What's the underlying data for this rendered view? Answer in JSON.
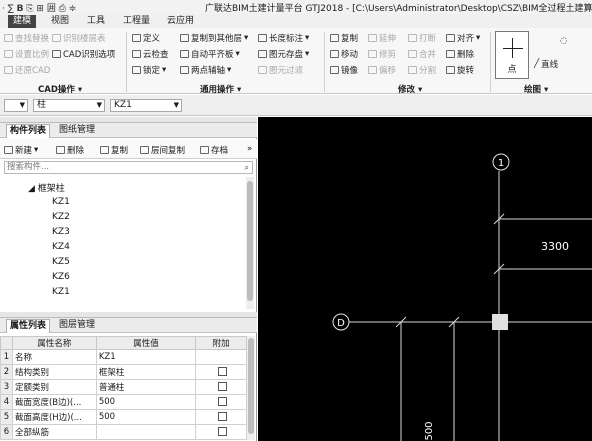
{
  "window": {
    "title": "广联达BIM土建计量平台 GTJ2018 - [C:\\Users\\Administrator\\Desktop\\CSZ\\BIM全过程土建算量实",
    "quick_access": "· ∑ 𝗕 ⎘ ⊞ 囲 ⎙ ≑"
  },
  "ribbon_tabs": [
    "建模",
    "视图",
    "工具",
    "工程量",
    "云应用"
  ],
  "ribbon": {
    "cad_group": {
      "label": "CAD操作",
      "commands": [
        "查找替换",
        "识别楼层表",
        "设置比例",
        "CAD识别选项",
        "还原CAD"
      ]
    },
    "general_group": {
      "label": "通用操作",
      "commands": [
        "定义",
        "复制到其他层",
        "长度标注",
        "云检查",
        "自动平齐板",
        "图元存盘",
        "锁定",
        "两点辅轴",
        "图元过滤"
      ]
    },
    "modify_group": {
      "label": "修改",
      "commands": [
        "复制",
        "延伸",
        "打断",
        "对齐",
        "移动",
        "修剪",
        "合并",
        "删除",
        "镜像",
        "偏移",
        "分割",
        "旋转"
      ]
    },
    "draw_group": {
      "label": "绘图",
      "point_label": "点",
      "line_label": "直线"
    }
  },
  "selectors": {
    "layer": "",
    "type": "柱",
    "component": "KZ1"
  },
  "component_panel": {
    "tabs": [
      "构件列表",
      "图纸管理"
    ],
    "toolbar": [
      "新建",
      "删除",
      "复制",
      "层间复制",
      "存档",
      "»"
    ],
    "search_placeholder": "搜索构件...",
    "tree_root": "框架柱",
    "items": [
      "KZ1",
      "KZ2",
      "KZ3",
      "KZ4",
      "KZ5",
      "KZ6",
      "KZ1"
    ]
  },
  "property_panel": {
    "tabs": [
      "属性列表",
      "图层管理"
    ],
    "columns": [
      "属性名称",
      "属性值",
      "附加"
    ],
    "rows": [
      {
        "num": "1",
        "name": "名称",
        "value": "KZ1"
      },
      {
        "num": "2",
        "name": "结构类别",
        "value": "框架柱"
      },
      {
        "num": "3",
        "name": "定额类别",
        "value": "普通柱"
      },
      {
        "num": "4",
        "name": "截面宽度(B边)(...",
        "value": "500"
      },
      {
        "num": "5",
        "name": "截面高度(H边)(...",
        "value": "500"
      },
      {
        "num": "6",
        "name": "全部纵筋",
        "value": ""
      }
    ]
  },
  "canvas": {
    "axis_top_label": "1",
    "axis_left_label": "D",
    "dimension_label": "3300",
    "vertical_dimension_label": "500"
  }
}
